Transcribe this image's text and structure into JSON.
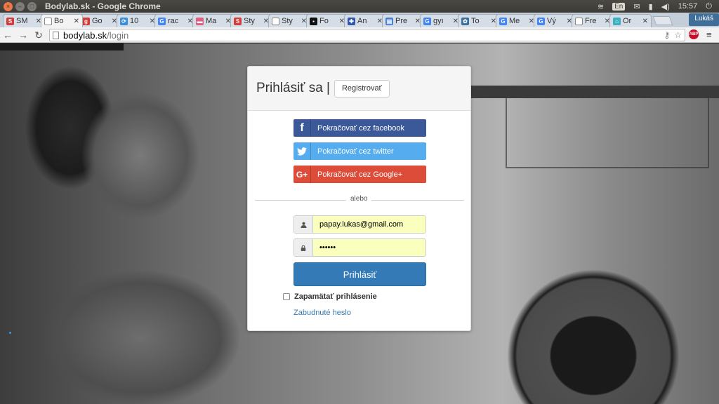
{
  "window": {
    "title": "Bodylab.sk - Google Chrome",
    "tray": {
      "keyboard": "En",
      "time": "15:57",
      "user": "Lukáš"
    }
  },
  "tabs": [
    {
      "label": "SM",
      "favicon_color": "#d43c3c",
      "favicon_glyph": "S",
      "active": false
    },
    {
      "label": "Bo",
      "favicon_color": "#ffffff",
      "favicon_glyph": "",
      "active": true
    },
    {
      "label": "Go",
      "favicon_color": "#d43c3c",
      "favicon_glyph": "g",
      "active": false
    },
    {
      "label": "10",
      "favicon_color": "#3b8fd8",
      "favicon_glyph": "⟳",
      "active": false
    },
    {
      "label": "rac",
      "favicon_color": "#4285f4",
      "favicon_glyph": "G",
      "active": false
    },
    {
      "label": "Ma",
      "favicon_color": "#e06080",
      "favicon_glyph": "▬",
      "active": false
    },
    {
      "label": "Sty",
      "favicon_color": "#d43c3c",
      "favicon_glyph": "S",
      "active": false
    },
    {
      "label": "Sty",
      "favicon_color": "#ffffff",
      "favicon_glyph": "",
      "active": false
    },
    {
      "label": "Fo",
      "favicon_color": "#111111",
      "favicon_glyph": "▪",
      "active": false
    },
    {
      "label": "An",
      "favicon_color": "#3355aa",
      "favicon_glyph": "✚",
      "active": false
    },
    {
      "label": "Pre",
      "favicon_color": "#4a7fd4",
      "favicon_glyph": "▤",
      "active": false
    },
    {
      "label": "gyı",
      "favicon_color": "#4285f4",
      "favicon_glyph": "G",
      "active": false
    },
    {
      "label": "To",
      "favicon_color": "#3a6f9e",
      "favicon_glyph": "✿",
      "active": false
    },
    {
      "label": "Me",
      "favicon_color": "#4285f4",
      "favicon_glyph": "G",
      "active": false
    },
    {
      "label": "Vý",
      "favicon_color": "#4285f4",
      "favicon_glyph": "G",
      "active": false
    },
    {
      "label": "Fre",
      "favicon_color": "#ffffff",
      "favicon_glyph": "",
      "active": false
    },
    {
      "label": "Or",
      "favicon_color": "#3cb0c0",
      "favicon_glyph": "⌂",
      "active": false
    }
  ],
  "address": {
    "host": "bodylab.sk",
    "path": "/login"
  },
  "login": {
    "title": "Prihlásiť sa |",
    "register_label": "Registrovať",
    "facebook_label": "Pokračovať cez facebook",
    "twitter_label": "Pokračovať cez twitter",
    "google_label": "Pokračovať cez Google+",
    "divider_label": "alebo",
    "email_value": "papay.lukas@gmail.com",
    "password_value": "••••••",
    "submit_label": "Prihlásiť",
    "remember_label": "Zapamätať prihlásenie",
    "forgot_label": "Zabudnuté heslo"
  },
  "colors": {
    "facebook": "#3b5998",
    "twitter": "#55acee",
    "google": "#dd4b39",
    "primary": "#337ab7",
    "autofill": "#faffbd"
  }
}
